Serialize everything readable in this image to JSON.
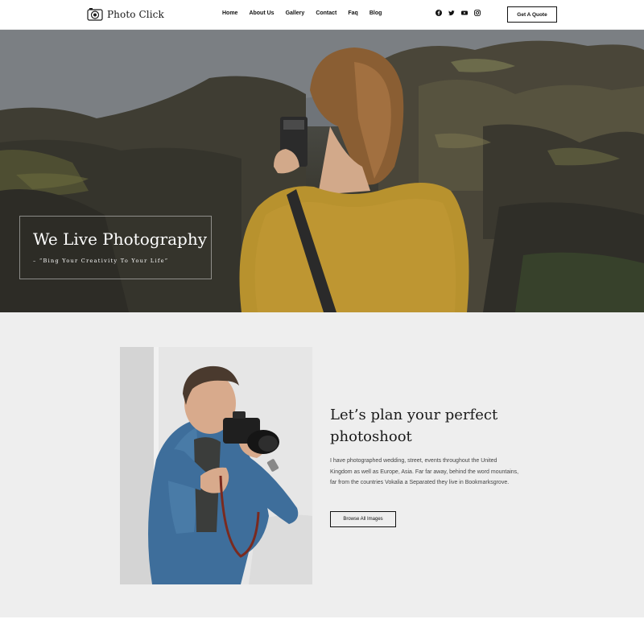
{
  "header": {
    "logo_text": "Photo Click",
    "nav": [
      "Home",
      "About Us",
      "Gallery",
      "Contact",
      "Faq",
      "Blog"
    ],
    "socials": [
      "facebook-icon",
      "twitter-icon",
      "youtube-icon",
      "instagram-icon"
    ],
    "quote_button": "Get A Quote"
  },
  "hero": {
    "title": "We Live Photography",
    "subtitle": "– “Bing Your Creativity To Your Life”"
  },
  "about": {
    "heading": "Let’s plan your perfect photoshoot",
    "text": "I have photographed wedding, street, events throughout the United Kingdom as well as Europe, Asia. Far far away, behind the word mountains, far from the countries Vokalia a Separated they live in Bookmarksgrove.",
    "button": "Browse All Images"
  },
  "colors": {
    "accent": "#111111",
    "section_bg": "#eeeeee",
    "sweater": "#b8922e"
  }
}
